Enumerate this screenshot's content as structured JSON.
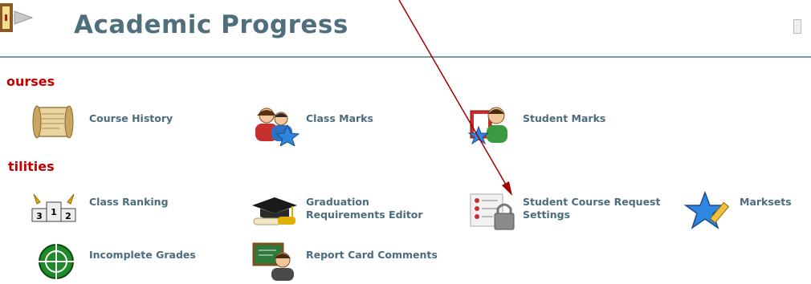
{
  "header": {
    "title": "Academic Progress"
  },
  "sections": [
    {
      "label": "ourses"
    },
    {
      "label": "tilities"
    }
  ],
  "courses_items": [
    {
      "label": "Course History",
      "icon": "scroll-icon"
    },
    {
      "label": "Class Marks",
      "icon": "class-marks-icon"
    },
    {
      "label": "Student Marks",
      "icon": "student-marks-icon"
    }
  ],
  "utilities_items": [
    {
      "label": "Class Ranking",
      "icon": "podium-icon"
    },
    {
      "label": "Graduation Requirements Editor",
      "line1": "Graduation",
      "line2": "Requirements Editor",
      "icon": "graduation-cap-icon"
    },
    {
      "label": "Student Course Request Settings",
      "line1": "Student Course Request",
      "line2": "Settings",
      "icon": "locked-list-icon"
    },
    {
      "label": "Marksets",
      "icon": "star-pencil-icon"
    },
    {
      "label": "Incomplete Grades",
      "icon": "crosshair-icon"
    },
    {
      "label": "Report Card Comments",
      "icon": "teacher-board-icon"
    }
  ],
  "colors": {
    "title": "#4f6f7e",
    "section": "#c40000",
    "link": "#4a6c7d",
    "rule": "#7a9aa8",
    "arrow": "#a00000"
  }
}
